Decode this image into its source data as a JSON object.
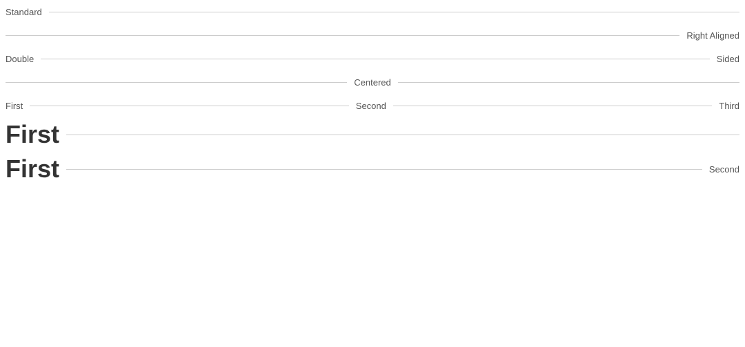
{
  "dividers": {
    "standard": {
      "label": "Standard"
    },
    "right_aligned": {
      "label": "Right Aligned"
    },
    "double": {
      "left_label": "Double",
      "right_label": "Sided"
    },
    "centered": {
      "label": "Centered"
    },
    "three_part": {
      "first": "First",
      "second": "Second",
      "third": "Third"
    },
    "big_first_1": {
      "big_label": "First"
    },
    "big_first_2": {
      "big_label": "First",
      "right_label": "Second"
    }
  }
}
